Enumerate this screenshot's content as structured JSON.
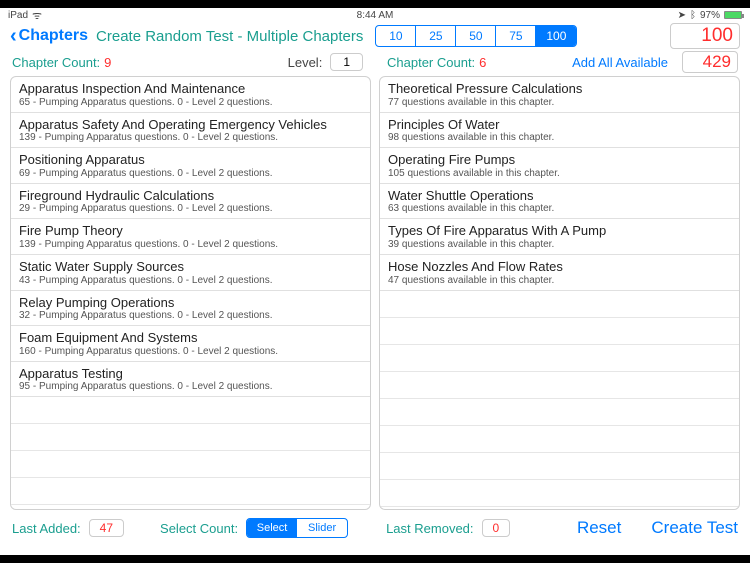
{
  "status": {
    "device": "iPad",
    "time": "8:44 AM",
    "battery": "97%"
  },
  "nav": {
    "back": "Chapters",
    "title": "Create Random Test - Multiple Chapters",
    "seg": [
      "10",
      "25",
      "50",
      "75",
      "100"
    ],
    "seg_on": 4,
    "big": "100"
  },
  "left": {
    "cc_label": "Chapter Count:",
    "cc": "9",
    "lvl_label": "Level:",
    "lvl": "1",
    "items": [
      {
        "t": "Apparatus Inspection And Maintenance",
        "s": "65 -  Pumping Apparatus questions.  0 -  Level 2 questions."
      },
      {
        "t": "Apparatus Safety And Operating Emergency Vehicles",
        "s": "139 -  Pumping Apparatus questions.  0 -  Level 2 questions."
      },
      {
        "t": "Positioning Apparatus",
        "s": "69 -  Pumping Apparatus questions.  0 -  Level 2 questions."
      },
      {
        "t": "Fireground Hydraulic Calculations",
        "s": "29 -  Pumping Apparatus questions.  0 -  Level 2 questions."
      },
      {
        "t": "Fire Pump Theory",
        "s": "139 -  Pumping Apparatus questions.  0 -  Level 2 questions."
      },
      {
        "t": "Static Water Supply Sources",
        "s": "43 -  Pumping Apparatus questions.  0 -  Level 2 questions."
      },
      {
        "t": "Relay Pumping Operations",
        "s": "32 -  Pumping Apparatus questions.  0 -  Level 2 questions."
      },
      {
        "t": "Foam Equipment And Systems",
        "s": "160 -  Pumping Apparatus questions.  0 -  Level 2 questions."
      },
      {
        "t": "Apparatus Testing",
        "s": "95 -  Pumping Apparatus questions.  0 -  Level 2 questions."
      }
    ]
  },
  "right": {
    "cc_label": "Chapter Count:",
    "cc": "6",
    "addall": "Add All Available",
    "total": "429",
    "items": [
      {
        "t": "Theoretical Pressure Calculations",
        "s": "77 questions available in this chapter."
      },
      {
        "t": "Principles Of Water",
        "s": "98 questions available in this chapter."
      },
      {
        "t": "Operating Fire Pumps",
        "s": "105 questions available in this chapter."
      },
      {
        "t": "Water Shuttle Operations",
        "s": "63 questions available in this chapter."
      },
      {
        "t": "Types Of Fire Apparatus With A Pump",
        "s": "39 questions available in this chapter."
      },
      {
        "t": "Hose Nozzles And Flow Rates",
        "s": "47 questions available in this chapter."
      }
    ]
  },
  "foot": {
    "la_label": "Last Added:",
    "la": "47",
    "sc_label": "Select Count:",
    "seg2": [
      "Select",
      "Slider"
    ],
    "seg2_on": 0,
    "lr_label": "Last Removed:",
    "lr": "0",
    "reset": "Reset",
    "create": "Create Test"
  }
}
